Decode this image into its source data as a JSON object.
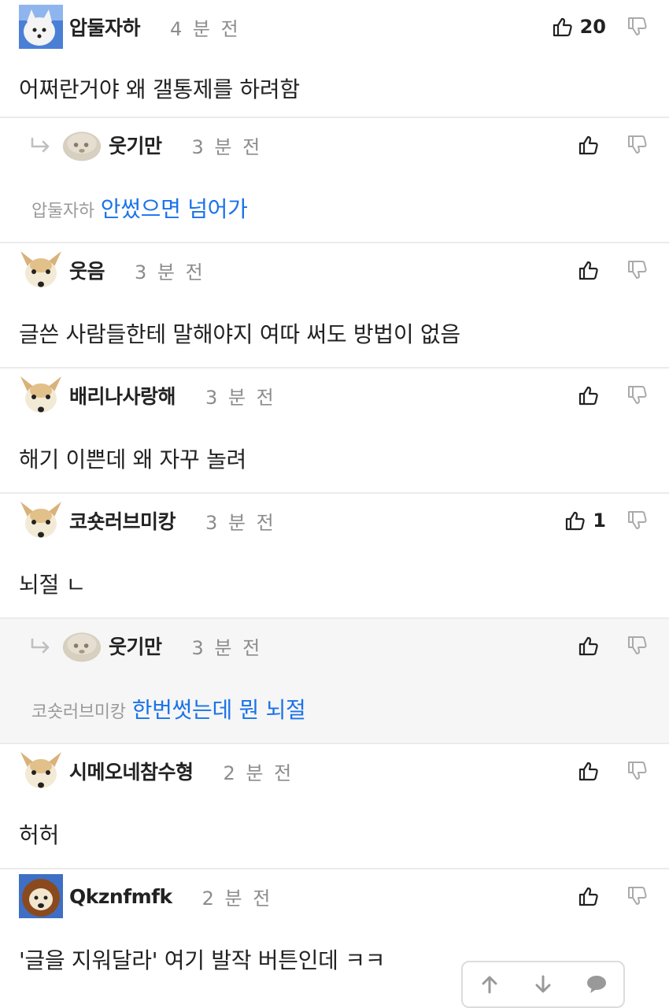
{
  "comments": [
    {
      "nickname": "압둘자하",
      "time": "4 분 전",
      "likes": "20",
      "text": "어쩌란거야 왜 갤통제를 하려함",
      "reply_to": "",
      "avatar": "dog-avatar",
      "reply": false
    },
    {
      "nickname": "웃기만",
      "time": "3 분 전",
      "likes": "",
      "text": "안썼으면 넘어가",
      "reply_to": "압둘자하",
      "avatar": "blob-avatar",
      "reply": true
    },
    {
      "nickname": "웃음",
      "time": "3 분 전",
      "likes": "",
      "text": "글쓴 사람들한테 말해야지 여따 써도 방법이 없음",
      "reply_to": "",
      "avatar": "fox-avatar",
      "reply": false
    },
    {
      "nickname": "배리나사랑해",
      "time": "3 분 전",
      "likes": "",
      "text": "해기 이쁜데 왜 자꾸 놀려",
      "reply_to": "",
      "avatar": "fox-avatar",
      "reply": false
    },
    {
      "nickname": "코숏러브미캉",
      "time": "3 분 전",
      "likes": "1",
      "text": "뇌절 ㄴ",
      "reply_to": "",
      "avatar": "fox-avatar",
      "reply": false
    },
    {
      "nickname": "웃기만",
      "time": "3 분 전",
      "likes": "",
      "text": "한번썻는데 뭔 뇌절",
      "reply_to": "코숏러브미캉",
      "avatar": "blob-avatar",
      "reply": true
    },
    {
      "nickname": "시메오네참수형",
      "time": "2 분 전",
      "likes": "",
      "text": "허허",
      "reply_to": "",
      "avatar": "fox-avatar",
      "reply": false
    },
    {
      "nickname": "Qkznfmfk",
      "time": "2 분 전",
      "likes": "",
      "text": "'글을 지워달라' 여기 발작 버튼인데 ㅋㅋ",
      "reply_to": "",
      "avatar": "lion-avatar",
      "reply": false
    }
  ],
  "icons": {
    "like": "thumbs-up-icon",
    "dislike": "thumbs-down-icon",
    "reply": "reply-arrow-icon",
    "scroll_up": "arrow-up-icon",
    "scroll_down": "arrow-down-icon",
    "comment": "speech-bubble-icon"
  },
  "colors": {
    "mention": "#9a9a9a",
    "reply_text": "#1a73e8",
    "reply_bg": "#f6f6f6",
    "time": "#8c8c8c"
  }
}
